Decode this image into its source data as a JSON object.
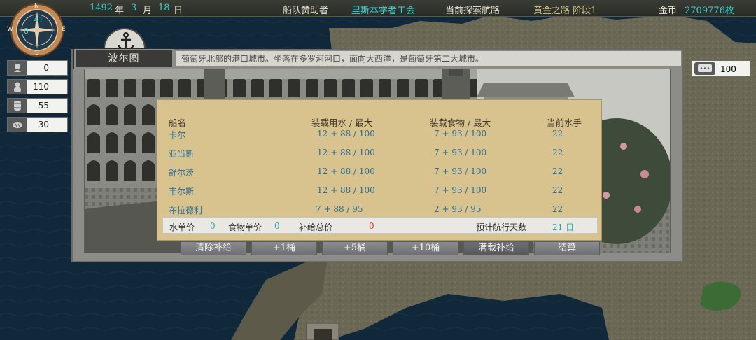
{
  "topbar": {
    "year": "1492",
    "year_unit": "年",
    "month": "3",
    "month_unit": "月",
    "day": "18",
    "day_unit": "日",
    "sponsor_label": "船队赞助者",
    "sponsor_value": "里斯本学者工会",
    "route_label": "当前探索航路",
    "route_value": "黄金之路 阶段1",
    "gold_label": "金币",
    "gold_value": "2709776枚"
  },
  "compass": {
    "n": "N",
    "s": "S",
    "e": "E",
    "w": "W",
    "value_top": "41",
    "value_left": "8"
  },
  "resources": {
    "sailors": "0",
    "crew": "110",
    "barrels": "55",
    "food": "30",
    "messages": "100"
  },
  "port": {
    "name": "波尔图",
    "description": "葡萄牙北部的港口城市。坐落在多罗河河口，面向大西洋，是葡萄牙第二大城市。"
  },
  "supply_table": {
    "headers": {
      "ship": "船名",
      "water": "装载用水 / 最大",
      "food": "装载食物 / 最大",
      "sailors": "当前水手"
    },
    "rows": [
      {
        "ship": "卡尔",
        "water": "12 + 88 / 100",
        "food": "7 + 93 / 100",
        "sailors": "22"
      },
      {
        "ship": "亚当斯",
        "water": "12 + 88 / 100",
        "food": "7 + 93 / 100",
        "sailors": "22"
      },
      {
        "ship": "舒尔茨",
        "water": "12 + 88 / 100",
        "food": "7 + 93 / 100",
        "sailors": "22"
      },
      {
        "ship": "韦尔斯",
        "water": "12 + 88 / 100",
        "food": "7 + 93 / 100",
        "sailors": "22"
      },
      {
        "ship": "布拉德利",
        "water": "7 + 88 / 95",
        "food": "2 + 93 / 95",
        "sailors": "22"
      }
    ],
    "summary": {
      "water_price_label": "水单价",
      "water_price": "0",
      "food_price_label": "食物单价",
      "food_price": "0",
      "total_label": "补给总价",
      "total": "0",
      "days_label": "预计航行天数",
      "days": "21 日"
    }
  },
  "buttons": {
    "clear": "清除补给",
    "plus1": "+1桶",
    "plus5": "+5桶",
    "plus10": "+10桶",
    "full": "满载补给",
    "settle": "结算"
  },
  "colors": {
    "accent_cyan": "#37d2cf",
    "route_gold": "#c9c38a",
    "table_bg": "#d8c38e",
    "total_red": "#d33a2a"
  }
}
